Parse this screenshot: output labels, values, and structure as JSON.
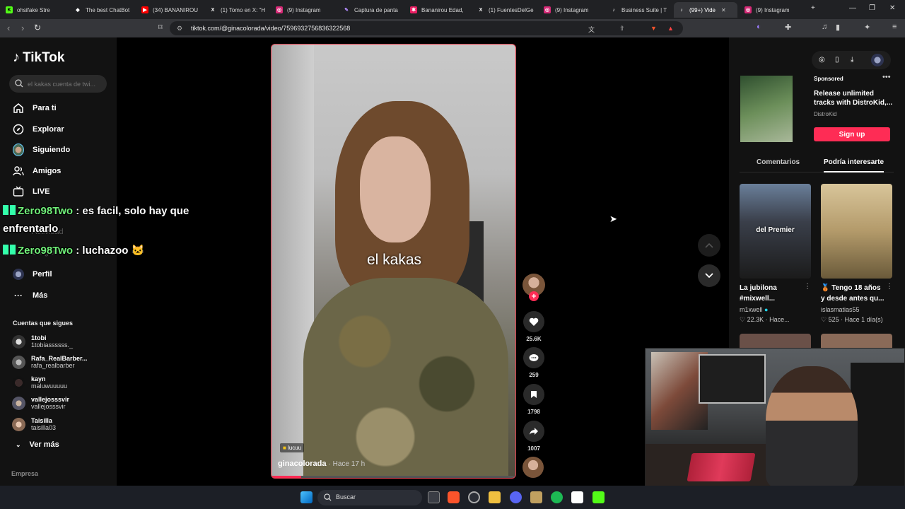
{
  "tabs": [
    {
      "title": "ohsifake Stre",
      "color": "#53fc18",
      "glyph": "K"
    },
    {
      "title": "The best ChatBot",
      "color": "#ffffff",
      "glyph": "◆"
    },
    {
      "title": "(34) BANANIROU",
      "color": "#ff0000",
      "glyph": "▶"
    },
    {
      "title": "(1) Tomo en X: \"H",
      "color": "#000000",
      "glyph": "X"
    },
    {
      "title": "(9) Instagram",
      "color": "#d62976",
      "glyph": "◎"
    },
    {
      "title": "Captura de panta",
      "color": "#b38cff",
      "glyph": "✎"
    },
    {
      "title": "Bananirou Edad,",
      "color": "#e91e63",
      "glyph": "✱"
    },
    {
      "title": "(1) FuentesDelGe",
      "color": "#000000",
      "glyph": "X"
    },
    {
      "title": "(9) Instagram",
      "color": "#d62976",
      "glyph": "◎"
    },
    {
      "title": "Business Suite | T",
      "color": "#000000",
      "glyph": "♪"
    },
    {
      "title": "(99+) Vide",
      "color": "#000000",
      "glyph": "♪",
      "active": true
    },
    {
      "title": "(9) Instagram",
      "color": "#d62976",
      "glyph": "◎"
    }
  ],
  "browser": {
    "url": "tiktok.com/@ginacolorada/video/7596932756836322568"
  },
  "sidebar": {
    "logo": "TikTok",
    "search_placeholder": "el kakas cuenta de twi...",
    "nav": [
      "Para ti",
      "Explorar",
      "Siguiendo",
      "Amigos",
      "LIVE",
      "Actividad",
      "Cargar",
      "Perfil",
      "Más"
    ],
    "following_title": "Cuentas que sigues",
    "accounts": [
      {
        "name": "1tobi",
        "handle": "1tobiassssss._"
      },
      {
        "name": "Rafa_RealBarber...",
        "handle": "rafa_realbarber"
      },
      {
        "name": "kayn",
        "handle": "maluwuuuuu"
      },
      {
        "name": "vallejosssvir",
        "handle": "vallejosssvir"
      },
      {
        "name": "Taisilla",
        "handle": "taisilla03"
      }
    ],
    "more": "Ver más",
    "footer": "Empresa"
  },
  "chat": [
    {
      "user": "Zero98Two",
      "text": " : es facil, solo hay que",
      "cont": "enfrentarlo"
    },
    {
      "user": "Zero98Two",
      "text": " : luchazoo 🐱"
    }
  ],
  "video": {
    "caption": "el kakas",
    "tag": "lucuu",
    "author": "ginacolorada",
    "time": "· Hace 17 h",
    "progress": 0.12
  },
  "actions": {
    "likes": "25.6K",
    "comments": "259",
    "saves": "1798",
    "shares": "1007"
  },
  "ad": {
    "sponsored": "Sponsored",
    "title": "Release unlimited tracks with DistroKid,...",
    "brand": "DistroKid",
    "button": "Sign up"
  },
  "right_tabs": [
    "Comentarios",
    "Podría interesarte"
  ],
  "related": [
    {
      "overlay": "del Premier",
      "title": "La jubilona #mixwell...",
      "author": "m1xwell",
      "likes": "22.3K",
      "time": "Hace..."
    },
    {
      "overlay": "",
      "title": "🥉 Tengo 18 años y desde antes qu...",
      "author": "islasmatias55",
      "likes": "525",
      "time": "Hace 1 día(s)"
    }
  ],
  "taskbar": {
    "search": "Buscar"
  },
  "colors": {
    "accent": "#fe2c55",
    "bg": "#000000",
    "panel": "#121212"
  }
}
